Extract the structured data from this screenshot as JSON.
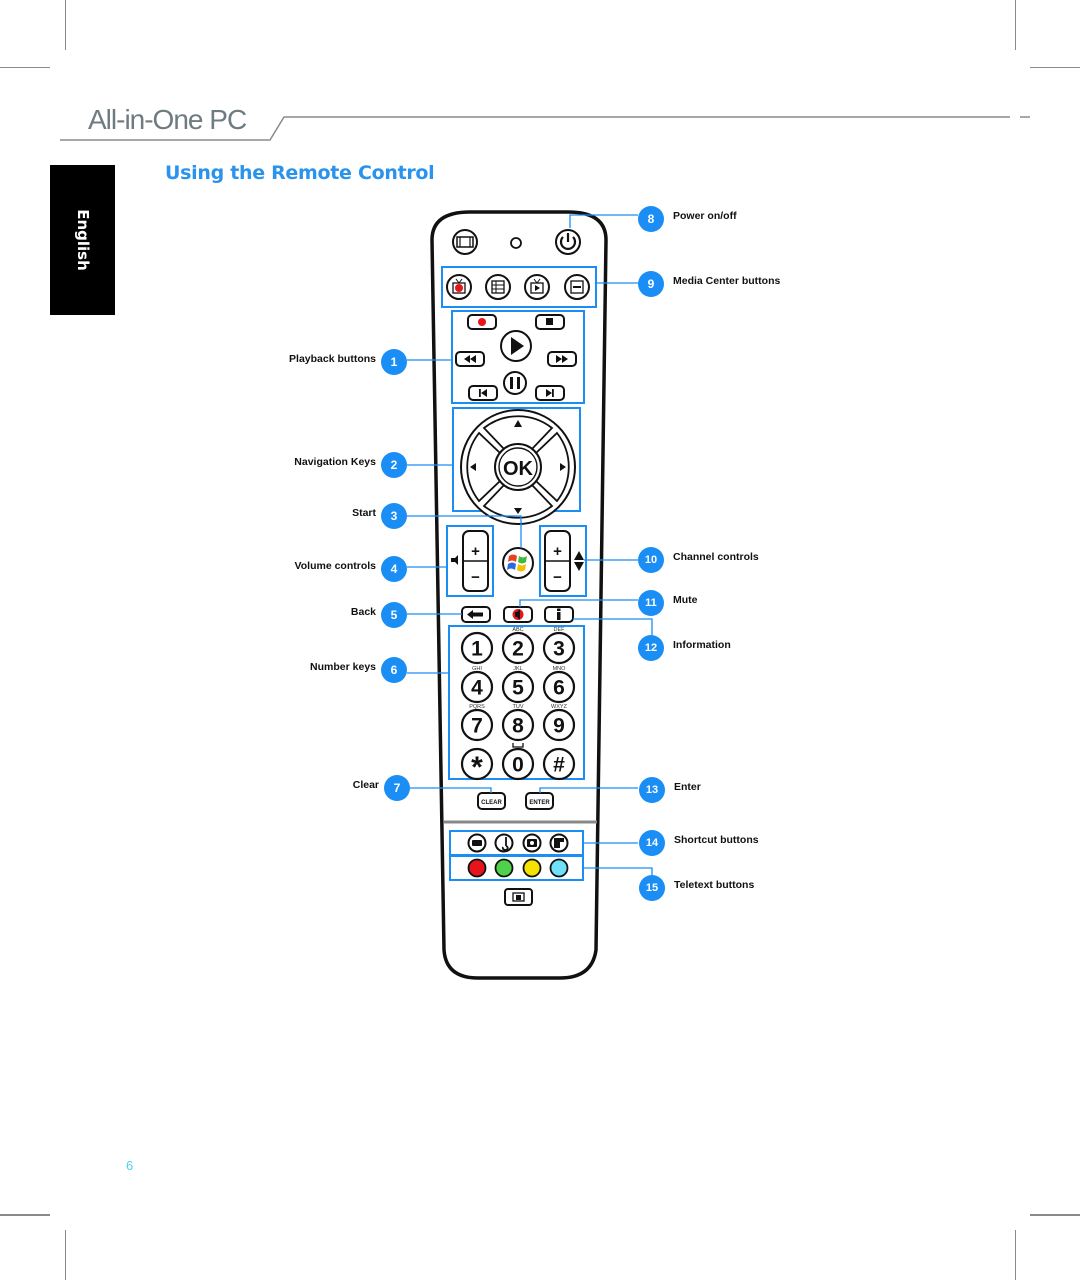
{
  "header": {
    "brand": "All-in-One PC",
    "section_title": "Using the Remote Control",
    "language_tab": "English"
  },
  "footer": {
    "page_number": "6"
  },
  "colors": {
    "accent": "#1a8ef5",
    "title": "#2a93ee",
    "brand_gray": "#6e7b80",
    "page_number": "#4fd0f0",
    "callout_line": "#1a8ef5"
  },
  "callouts": [
    {
      "number": "1",
      "label": "Playback buttons",
      "side": "left"
    },
    {
      "number": "2",
      "label": "Navigation Keys",
      "side": "left"
    },
    {
      "number": "3",
      "label": "Start",
      "side": "left"
    },
    {
      "number": "4",
      "label": "Volume controls",
      "side": "left"
    },
    {
      "number": "5",
      "label": "Back",
      "side": "left"
    },
    {
      "number": "6",
      "label": "Number keys",
      "side": "left"
    },
    {
      "number": "7",
      "label": "Clear",
      "side": "left"
    },
    {
      "number": "8",
      "label": "Power on/off",
      "side": "right"
    },
    {
      "number": "9",
      "label": "Media Center buttons",
      "side": "right"
    },
    {
      "number": "10",
      "label": "Channel controls",
      "side": "right"
    },
    {
      "number": "11",
      "label": "Mute",
      "side": "right"
    },
    {
      "number": "12",
      "label": "Information",
      "side": "right"
    },
    {
      "number": "13",
      "label": "Enter",
      "side": "right"
    },
    {
      "number": "14",
      "label": "Shortcut buttons",
      "side": "right"
    },
    {
      "number": "15",
      "label": "Teletext buttons",
      "side": "right"
    }
  ],
  "remote": {
    "top_buttons": [
      "aspect-ratio-icon",
      "indicator-led",
      "power-icon"
    ],
    "media_center_buttons": [
      "live-tv-icon",
      "guide-icon",
      "recorded-tv-icon",
      "dvd-menu-icon"
    ],
    "playback": [
      "record-icon",
      "stop-icon",
      "rewind-icon",
      "play-icon",
      "fast-forward-icon",
      "pause-icon",
      "skip-back-icon",
      "skip-forward-icon"
    ],
    "ok_label": "OK",
    "volume": {
      "plus": "+",
      "minus": "−"
    },
    "channel": {
      "plus": "+",
      "minus": "−"
    },
    "number_keys": [
      {
        "digit": "1",
        "letters": ""
      },
      {
        "digit": "2",
        "letters": "ABC"
      },
      {
        "digit": "3",
        "letters": "DEF"
      },
      {
        "digit": "4",
        "letters": "GHI"
      },
      {
        "digit": "5",
        "letters": "JKL"
      },
      {
        "digit": "6",
        "letters": "MNO"
      },
      {
        "digit": "7",
        "letters": "PQRS"
      },
      {
        "digit": "8",
        "letters": "TUV"
      },
      {
        "digit": "9",
        "letters": "WXYZ"
      },
      {
        "digit": "*",
        "letters": ""
      },
      {
        "digit": "0",
        "letters": ""
      },
      {
        "digit": "#",
        "letters": ""
      }
    ],
    "clear_label": "CLEAR",
    "enter_label": "ENTER",
    "shortcut_buttons": [
      "radio-icon",
      "music-icon",
      "pictures-icon",
      "videos-icon"
    ],
    "teletext_colors": [
      {
        "name": "red",
        "hex": "#e8141b"
      },
      {
        "name": "green",
        "hex": "#4fd24a"
      },
      {
        "name": "yellow",
        "hex": "#f6e200"
      },
      {
        "name": "blue",
        "hex": "#6fe0f8"
      }
    ],
    "teletext_button": "teletext-icon"
  }
}
